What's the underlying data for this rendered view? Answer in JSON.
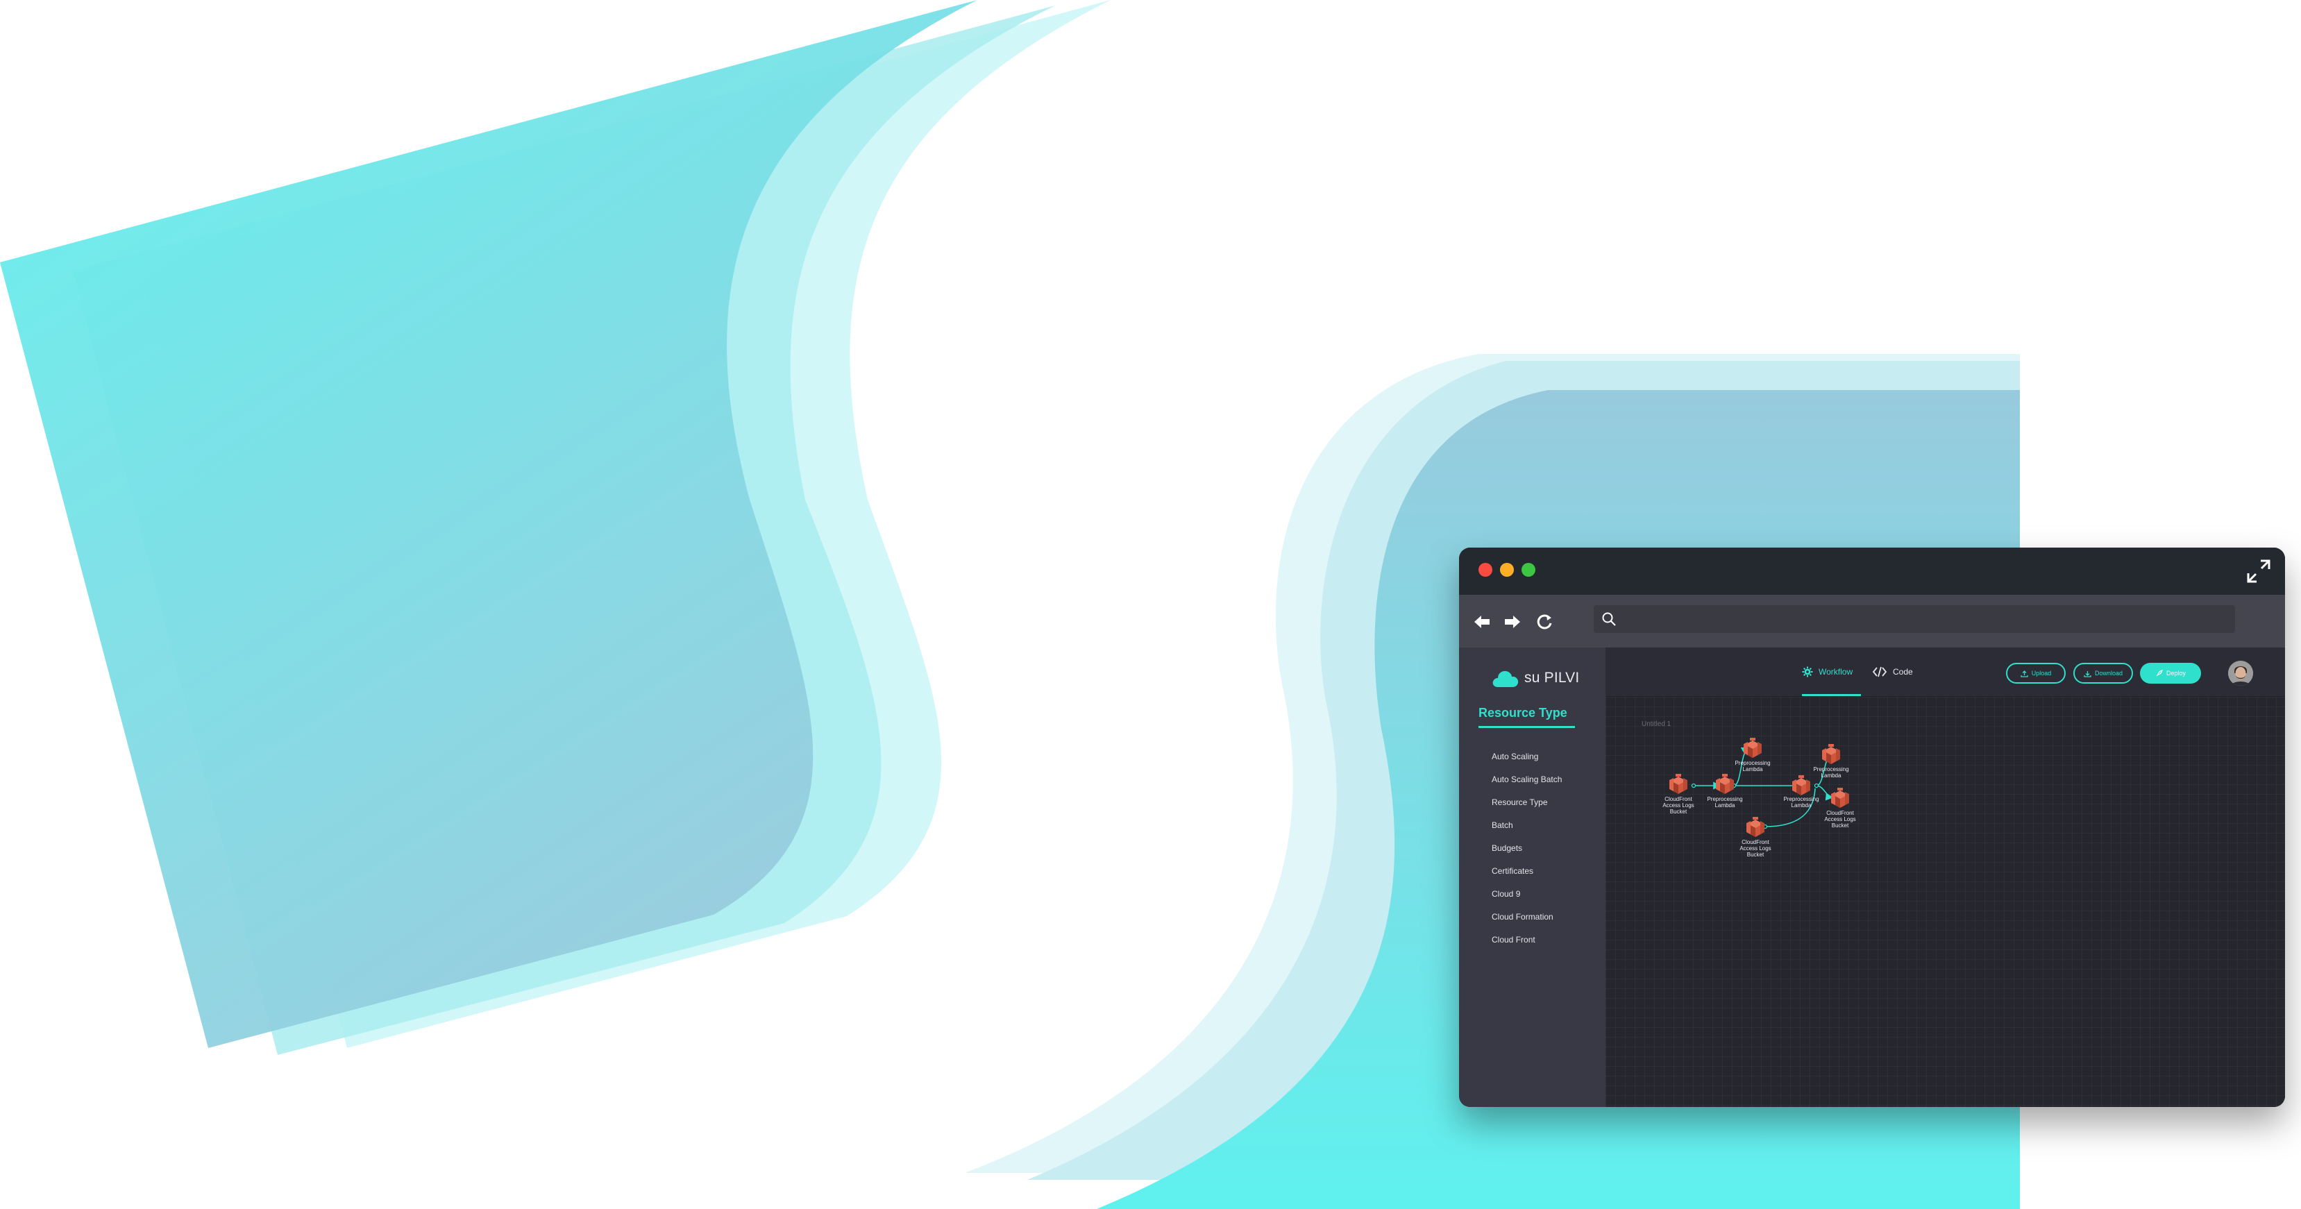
{
  "window": {
    "traffic_lights": [
      "#fa4b43",
      "#fdb025",
      "#3dc641"
    ],
    "fullscreen_icon": "expand-arrows-icon"
  },
  "browser": {
    "back_icon": "arrow-left-icon",
    "forward_icon": "arrow-right-icon",
    "reload_icon": "reload-icon",
    "search_icon": "search-icon",
    "address": ""
  },
  "brand": {
    "logo_icon": "cloud-icon",
    "name": "su PILVI",
    "accent": "#2fe0cc"
  },
  "sidebar": {
    "heading": "Resource Type",
    "items": [
      {
        "label": "Auto Scaling"
      },
      {
        "label": "Auto Scaling Batch"
      },
      {
        "label": "Resource Type"
      },
      {
        "label": "Batch"
      },
      {
        "label": "Budgets"
      },
      {
        "label": "Certificates"
      },
      {
        "label": "Cloud 9"
      },
      {
        "label": "Cloud Formation"
      },
      {
        "label": "Cloud Front"
      }
    ]
  },
  "tabs": {
    "workflow": "Workflow",
    "code": "Code",
    "active": "workflow"
  },
  "actions": {
    "upload": "Upload",
    "download": "Download",
    "deploy": "Deploy"
  },
  "canvas": {
    "document_title": "Untitled 1",
    "node_color": "#d2553c",
    "edge_color": "#2fe0cc",
    "nodes": [
      {
        "id": "n1",
        "lines": [
          "CloudFront",
          "Access Logs",
          "Bucket"
        ]
      },
      {
        "id": "n2",
        "lines": [
          "Preprocessing",
          "Lambda"
        ]
      },
      {
        "id": "n3",
        "lines": [
          "Preprocessing",
          "Lambda"
        ]
      },
      {
        "id": "n4",
        "lines": [
          "Preprocessing",
          "Lambda"
        ]
      },
      {
        "id": "n5",
        "lines": [
          "Preprocessing",
          "Lambda"
        ]
      },
      {
        "id": "n6",
        "lines": [
          "CloudFront",
          "Access Logs",
          "Bucket"
        ]
      },
      {
        "id": "n7",
        "lines": [
          "CloudFront",
          "Access Logs",
          "Bucket"
        ]
      }
    ],
    "edges": [
      [
        "n1",
        "n2"
      ],
      [
        "n2",
        "n3"
      ],
      [
        "n2",
        "n4"
      ],
      [
        "n4",
        "n5"
      ],
      [
        "n4",
        "n6"
      ],
      [
        "n7",
        "n4"
      ]
    ]
  }
}
